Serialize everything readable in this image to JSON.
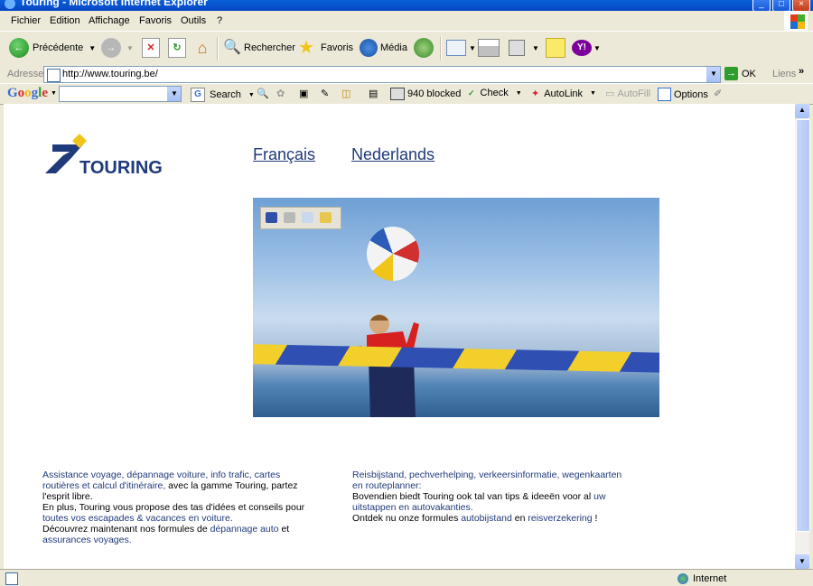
{
  "window": {
    "title": "Touring - Microsoft Internet Explorer"
  },
  "menu": [
    "Fichier",
    "Edition",
    "Affichage",
    "Favoris",
    "Outils",
    "?"
  ],
  "toolbar": {
    "back_label": "Précédente",
    "search_label": "Rechercher",
    "favorites_label": "Favoris",
    "media_label": "Média"
  },
  "address": {
    "label": "Adresse",
    "url": "http://www.touring.be/",
    "go_label": "OK",
    "links_label": "Liens"
  },
  "googlebar": {
    "logo": "Google",
    "search_label": "Search",
    "blocked_label": "940 blocked",
    "check_label": "Check",
    "autolink_label": "AutoLink",
    "autofill_label": "AutoFill",
    "options_label": "Options"
  },
  "page": {
    "logo_text": "TOURING",
    "lang_fr": "Français",
    "lang_nl": "Nederlands",
    "fr_text": {
      "l1": "Assistance voyage, dépannage voiture, info trafic, cartes",
      "l2": "routières et calcul d'itinéraire,",
      "l2b": " avec la gamme Touring, partez",
      "l3": "l'esprit libre.",
      "l4": "En plus, Touring vous propose des tas d'idées et conseils pour",
      "l5": "toutes vos escapades & vacances en voiture.",
      "l6a": "Découvrez maintenant nos formules de ",
      "l6b": "dépannage auto",
      "l6c": " et",
      "l7": "assurances voyages."
    },
    "nl_text": {
      "l1": "Reisbijstand, pechverhelping, verkeersinformatie, wegenkaarten",
      "l2": "en routeplanner:",
      "l3a": "Bovendien biedt Touring ook tal van tips & ideeën voor al ",
      "l3b": "uw",
      "l4": "uitstappen en autovakanties.",
      "l5a": "Ontdek nu onze formules ",
      "l5b": "autobijstand",
      "l5c": " en ",
      "l5d": "reisverzekering",
      "l5e": " !"
    }
  },
  "status": {
    "zone": "Internet"
  },
  "colors": {
    "title_bar": "#0a5fd9",
    "link": "#1f3a7a",
    "logo_blue": "#1f3a7a",
    "logo_yellow": "#f0c419"
  }
}
